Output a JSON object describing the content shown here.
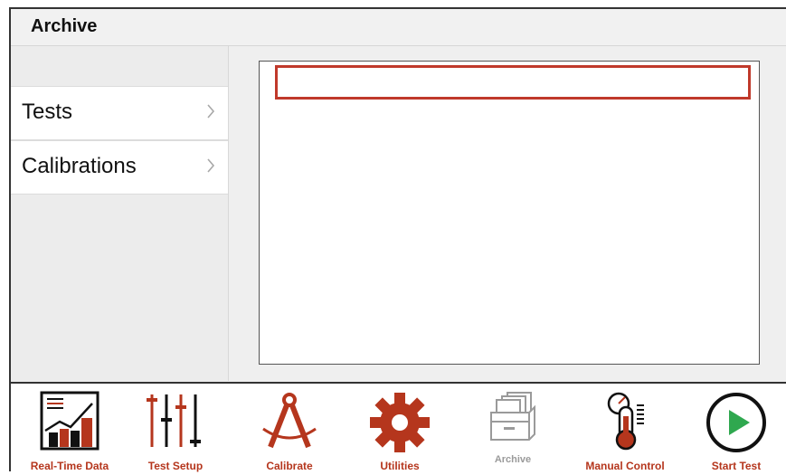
{
  "header": {
    "title": "Archive"
  },
  "sidebar": {
    "items": [
      {
        "label": "Tests"
      },
      {
        "label": "Calibrations"
      }
    ]
  },
  "toolbar": {
    "items": [
      {
        "label": "Real-Time Data",
        "icon": "chart-icon",
        "enabled": true
      },
      {
        "label": "Test Setup",
        "icon": "sliders-icon",
        "enabled": true
      },
      {
        "label": "Calibrate",
        "icon": "compass-icon",
        "enabled": true
      },
      {
        "label": "Utilities",
        "icon": "gear-icon",
        "enabled": true
      },
      {
        "label": "Archive",
        "icon": "file-cabinet-icon",
        "enabled": false
      },
      {
        "label": "Manual Control",
        "icon": "thermometer-gauge-icon",
        "enabled": true
      },
      {
        "label": "Start Test",
        "icon": "play-icon",
        "enabled": true
      }
    ]
  },
  "colors": {
    "accent": "#c0392b",
    "disabled": "#9a9a9a",
    "play": "#2fa84f"
  }
}
